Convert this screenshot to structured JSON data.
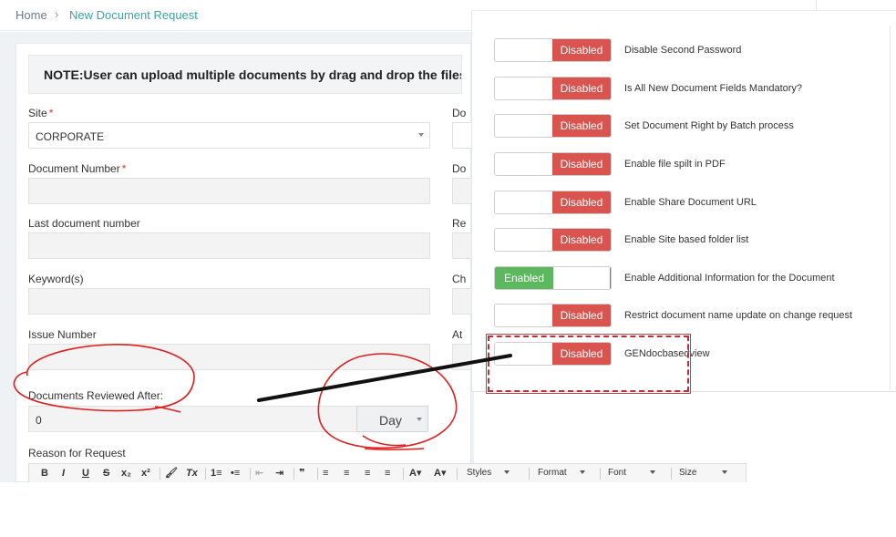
{
  "breadcrumb": {
    "home": "Home",
    "separator": "›",
    "current": "New Document Request"
  },
  "note": "NOTE:User can upload multiple documents by drag and drop the files or m",
  "form": {
    "site": {
      "label": "Site",
      "required": "*",
      "value": "CORPORATE"
    },
    "document_number": {
      "label": "Document Number",
      "required": "*",
      "value": ""
    },
    "last_document_number": {
      "label": "Last document number",
      "value": ""
    },
    "keywords": {
      "label": "Keyword(s)",
      "value": ""
    },
    "issue_number": {
      "label": "Issue Number",
      "value": ""
    },
    "documents_reviewed_after": {
      "label": "Documents Reviewed After:",
      "value": "0",
      "unit": "Day"
    },
    "reason_for_request": {
      "label": "Reason for Request"
    }
  },
  "right_column_labels": [
    "Do",
    "Do",
    "Re",
    "Ch",
    "At"
  ],
  "toolbar": {
    "buttons": [
      "B",
      "I",
      "U",
      "S",
      "x₂",
      "x²",
      "🖌",
      "Tx",
      "1≡",
      "•≡",
      "⇤",
      "⇥",
      "❞",
      "≡",
      "≡",
      "≡",
      "≡",
      "A▾",
      "A▾"
    ],
    "combos": [
      "Styles",
      "Format",
      "Font",
      "Size"
    ]
  },
  "settings": [
    {
      "state": "Disabled",
      "label": "Disable Second Password"
    },
    {
      "state": "Disabled",
      "label": "Is All New Document Fields Mandatory?"
    },
    {
      "state": "Disabled",
      "label": "Set Document Right by Batch process"
    },
    {
      "state": "Disabled",
      "label": "Enable file spilt in PDF"
    },
    {
      "state": "Disabled",
      "label": "Enable Share Document URL"
    },
    {
      "state": "Disabled",
      "label": "Enable Site based folder list"
    },
    {
      "state": "Enabled",
      "label": "Enable Additional Information for the Document"
    },
    {
      "state": "Disabled",
      "label": "Restrict document name update on change request"
    },
    {
      "state": "Disabled",
      "label": "GENdocbasedview"
    }
  ],
  "colors": {
    "enabled": "#5cb85c",
    "disabled": "#d9534f",
    "accent": "#3aa3a8",
    "annotation_red": "#e01e1e",
    "annotation_line": "#111111"
  }
}
